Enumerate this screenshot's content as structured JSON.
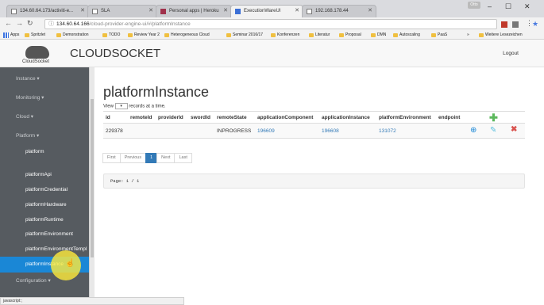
{
  "browser": {
    "tabs": [
      {
        "label": "134.60.64.173/activiti-e..."
      },
      {
        "label": "SLA"
      },
      {
        "label": "Personal apps | Heroku"
      },
      {
        "label": "ExecutionWareUI"
      },
      {
        "label": "192.168.178.44"
      }
    ],
    "profile": "Otto",
    "url_host": "134.60.64.166",
    "url_path": "/cloud-provider-engine-ui/#/platformInstance",
    "bookmarks": [
      "Apps",
      "Spritzlet",
      "Demonstration",
      "TODO",
      "Review Year 2",
      "Heterogeneous Cloud",
      "Seminar 2016/17",
      "Konferenzen",
      "Literatur",
      "Proposal",
      "DMN",
      "Autoscaling",
      "PaaS",
      "»",
      "Weitere Lesezeichen"
    ],
    "status_bar": "javascript:;"
  },
  "navbar": {
    "logo_text": "CloudSocket",
    "brand": "CLOUDSOCKET",
    "logout": "Logout"
  },
  "sidebar": {
    "items": [
      {
        "label": "Instance ▾"
      },
      {
        "label": "Monitoring ▾"
      },
      {
        "label": "Cloud ▾"
      },
      {
        "label": "Platform ▾"
      },
      {
        "label": "platform"
      },
      {
        "label": "platformApi"
      },
      {
        "label": "platformCredential"
      },
      {
        "label": "platformHardware"
      },
      {
        "label": "platformRuntime"
      },
      {
        "label": "platformEnvironment"
      },
      {
        "label": "platformEnvironmentTempl"
      },
      {
        "label": "platformInstance"
      },
      {
        "label": "Configuration ▾"
      }
    ]
  },
  "main": {
    "title": "platformInstance",
    "view_prefix": "View",
    "view_select": "",
    "view_suffix": "records at a time.",
    "columns": [
      "id",
      "remoteId",
      "providerId",
      "swordId",
      "remoteState",
      "applicationComponent",
      "applicationInstance",
      "platformEnvironment",
      "endpoint"
    ],
    "rows": [
      {
        "id": "229378",
        "remoteId": "",
        "providerId": "",
        "swordId": "",
        "remoteState": "INPROGRESS",
        "applicationComponent": "196609",
        "applicationInstance": "196608",
        "platformEnvironment": "131072",
        "endpoint": ""
      }
    ],
    "pager": [
      "First",
      "Previous",
      "1",
      "Next",
      "Last"
    ],
    "page_info": "Page: 1 / 1"
  },
  "colors": {
    "accent": "#1a87d6",
    "sidebar": "#565b60",
    "success": "#5cb85c",
    "danger": "#d9534f",
    "link": "#337ab7"
  }
}
